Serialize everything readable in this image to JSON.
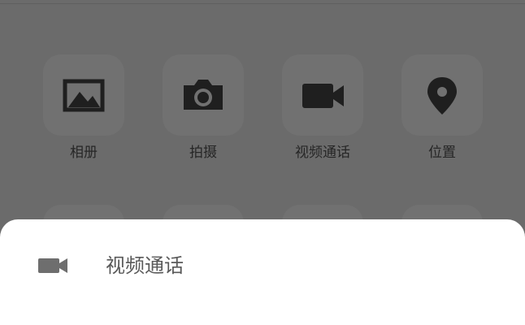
{
  "attachment_panel": {
    "items": [
      {
        "label": "相册",
        "icon": "photo-album-icon"
      },
      {
        "label": "拍摄",
        "icon": "camera-icon"
      },
      {
        "label": "视频通话",
        "icon": "video-camera-icon"
      },
      {
        "label": "位置",
        "icon": "location-pin-icon"
      }
    ]
  },
  "bottom_sheet": {
    "options": [
      {
        "label": "视频通话",
        "icon": "video-camera-icon"
      }
    ]
  },
  "colors": {
    "overlay": "#6b6b6b",
    "tile": "#717171",
    "icon": "#1f1f1f",
    "sheet": "#ffffff",
    "sheet_icon": "#6e6e6e"
  }
}
